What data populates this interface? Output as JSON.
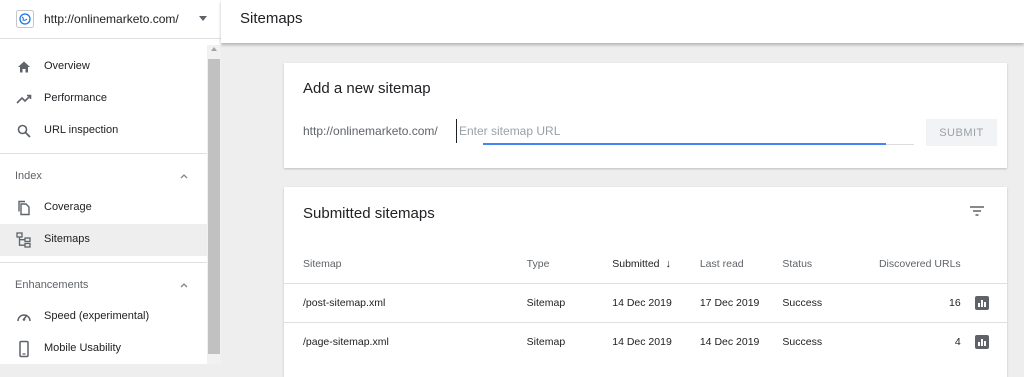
{
  "sidebar": {
    "property_url": "http://onlinemarketo.com/",
    "items": {
      "overview": "Overview",
      "performance": "Performance",
      "url_inspection": "URL inspection",
      "coverage": "Coverage",
      "sitemaps": "Sitemaps",
      "speed": "Speed (experimental)",
      "mobile_usability": "Mobile Usability"
    },
    "sections": {
      "index": "Index",
      "enhancements": "Enhancements"
    },
    "active_item": "sitemaps"
  },
  "header": {
    "title": "Sitemaps"
  },
  "add_sitemap": {
    "title": "Add a new sitemap",
    "url_prefix": "http://onlinemarketo.com/",
    "input_value": "",
    "input_placeholder": "Enter sitemap URL",
    "submit_label": "SUBMIT"
  },
  "submitted": {
    "title": "Submitted sitemaps",
    "columns": {
      "sitemap": "Sitemap",
      "type": "Type",
      "submitted": "Submitted",
      "last_read": "Last read",
      "status": "Status",
      "discovered": "Discovered URLs"
    },
    "sort_column": "submitted",
    "sort_direction": "descending",
    "rows": [
      {
        "sitemap": "/post-sitemap.xml",
        "type": "Sitemap",
        "submitted": "14 Dec 2019",
        "last_read": "17 Dec 2019",
        "status": "Success",
        "discovered": "16"
      },
      {
        "sitemap": "/page-sitemap.xml",
        "type": "Sitemap",
        "submitted": "14 Dec 2019",
        "last_read": "14 Dec 2019",
        "status": "Success",
        "discovered": "4"
      }
    ]
  },
  "colors": {
    "accent": "#4285f4",
    "success": "#188038",
    "background": "#eeeeee",
    "active_nav": "#eeeeee"
  },
  "icons": {
    "property": "globe-icon",
    "overview": "home-icon",
    "performance": "trending-up-icon",
    "url_inspection": "search-icon",
    "coverage": "copy-pages-icon",
    "sitemaps": "sitemap-tree-icon",
    "speed": "speedometer-icon",
    "mobile_usability": "smartphone-icon",
    "filter": "filter-icon",
    "report": "bar-chart-icon"
  }
}
